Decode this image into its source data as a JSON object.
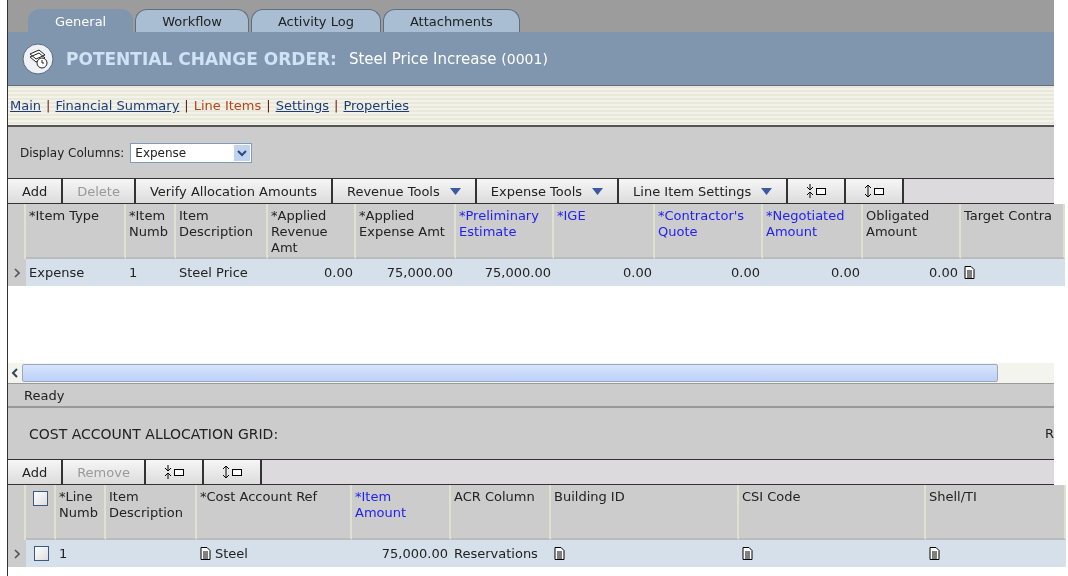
{
  "tabs": [
    {
      "label": "General",
      "selected": true
    },
    {
      "label": "Workflow",
      "selected": false
    },
    {
      "label": "Activity Log",
      "selected": false
    },
    {
      "label": "Attachments",
      "selected": false
    }
  ],
  "header": {
    "title": "POTENTIAL CHANGE ORDER:",
    "name": "Steel Price Increase",
    "number": "(0001)"
  },
  "nav_separator": "|",
  "nav_links": [
    {
      "label": "Main",
      "selected": false
    },
    {
      "label": "Financial Summary",
      "selected": false
    },
    {
      "label": "Line Items",
      "selected": true
    },
    {
      "label": "Settings",
      "selected": false
    },
    {
      "label": "Properties",
      "selected": false
    }
  ],
  "display_columns": {
    "label": "Display Columns:",
    "value": "Expense"
  },
  "line_items": {
    "toolbar": [
      {
        "kind": "text",
        "label": "Add",
        "disabled": false
      },
      {
        "kind": "text",
        "label": "Delete",
        "disabled": true
      },
      {
        "kind": "text",
        "label": "Verify Allocation Amounts",
        "disabled": false
      },
      {
        "kind": "menu",
        "label": "Revenue Tools",
        "disabled": false
      },
      {
        "kind": "menu",
        "label": "Expense Tools",
        "disabled": false
      },
      {
        "kind": "menu",
        "label": "Line Item Settings",
        "disabled": false
      },
      {
        "kind": "collapse"
      },
      {
        "kind": "expand"
      }
    ],
    "columns": [
      {
        "label": "*Item Type",
        "highlighted": false
      },
      {
        "label": "*Item Numb",
        "highlighted": false
      },
      {
        "label": "Item Description",
        "highlighted": false
      },
      {
        "label": "*Applied Revenue Amt",
        "highlighted": false
      },
      {
        "label": "*Applied Expense Amt",
        "highlighted": false
      },
      {
        "label": "*Preliminary Estimate",
        "highlighted": true
      },
      {
        "label": "*IGE",
        "highlighted": true
      },
      {
        "label": "*Contractor's Quote",
        "highlighted": true
      },
      {
        "label": "*Negotiated Amount",
        "highlighted": true
      },
      {
        "label": "Obligated Amount",
        "highlighted": false
      },
      {
        "label": "Target Contra",
        "highlighted": false
      }
    ],
    "rows": [
      {
        "cells": [
          {
            "kind": "text",
            "text": "Expense"
          },
          {
            "kind": "text",
            "text": "1"
          },
          {
            "kind": "text",
            "text": "Steel Price"
          },
          {
            "kind": "number",
            "text": "0.00"
          },
          {
            "kind": "number",
            "text": "75,000.00"
          },
          {
            "kind": "number",
            "text": "75,000.00"
          },
          {
            "kind": "number",
            "text": "0.00"
          },
          {
            "kind": "number",
            "text": "0.00"
          },
          {
            "kind": "number",
            "text": "0.00"
          },
          {
            "kind": "number",
            "text": "0.00"
          },
          {
            "kind": "lookup"
          }
        ]
      }
    ],
    "status": "Ready"
  },
  "cost_grid": {
    "title": "COST ACCOUNT ALLOCATION GRID:",
    "side_text": "R",
    "toolbar": [
      {
        "kind": "text",
        "label": "Add",
        "disabled": false
      },
      {
        "kind": "text",
        "label": "Remove",
        "disabled": true
      },
      {
        "kind": "collapse"
      },
      {
        "kind": "expand"
      }
    ],
    "select_all": {
      "checked": false
    },
    "columns": [
      {
        "label": "*Line Numb",
        "highlighted": false
      },
      {
        "label": "Item Description",
        "highlighted": false
      },
      {
        "label": "*Cost Account Ref",
        "highlighted": false
      },
      {
        "label": "*Item Amount",
        "highlighted": true
      },
      {
        "label": "ACR Column",
        "highlighted": false
      },
      {
        "label": "Building ID",
        "highlighted": false
      },
      {
        "label": "CSI Code",
        "highlighted": false
      },
      {
        "label": "Shell/TI",
        "highlighted": false
      }
    ],
    "rows": [
      {
        "checked": false,
        "cells": [
          {
            "kind": "text",
            "text": "1"
          },
          {
            "kind": "text"
          },
          {
            "kind": "lookup",
            "text": "Steel"
          },
          {
            "kind": "number",
            "text": "75,000.00"
          },
          {
            "kind": "text",
            "text": "Reservations"
          },
          {
            "kind": "lookup"
          },
          {
            "kind": "lookup"
          },
          {
            "kind": "lookup"
          }
        ]
      }
    ]
  }
}
